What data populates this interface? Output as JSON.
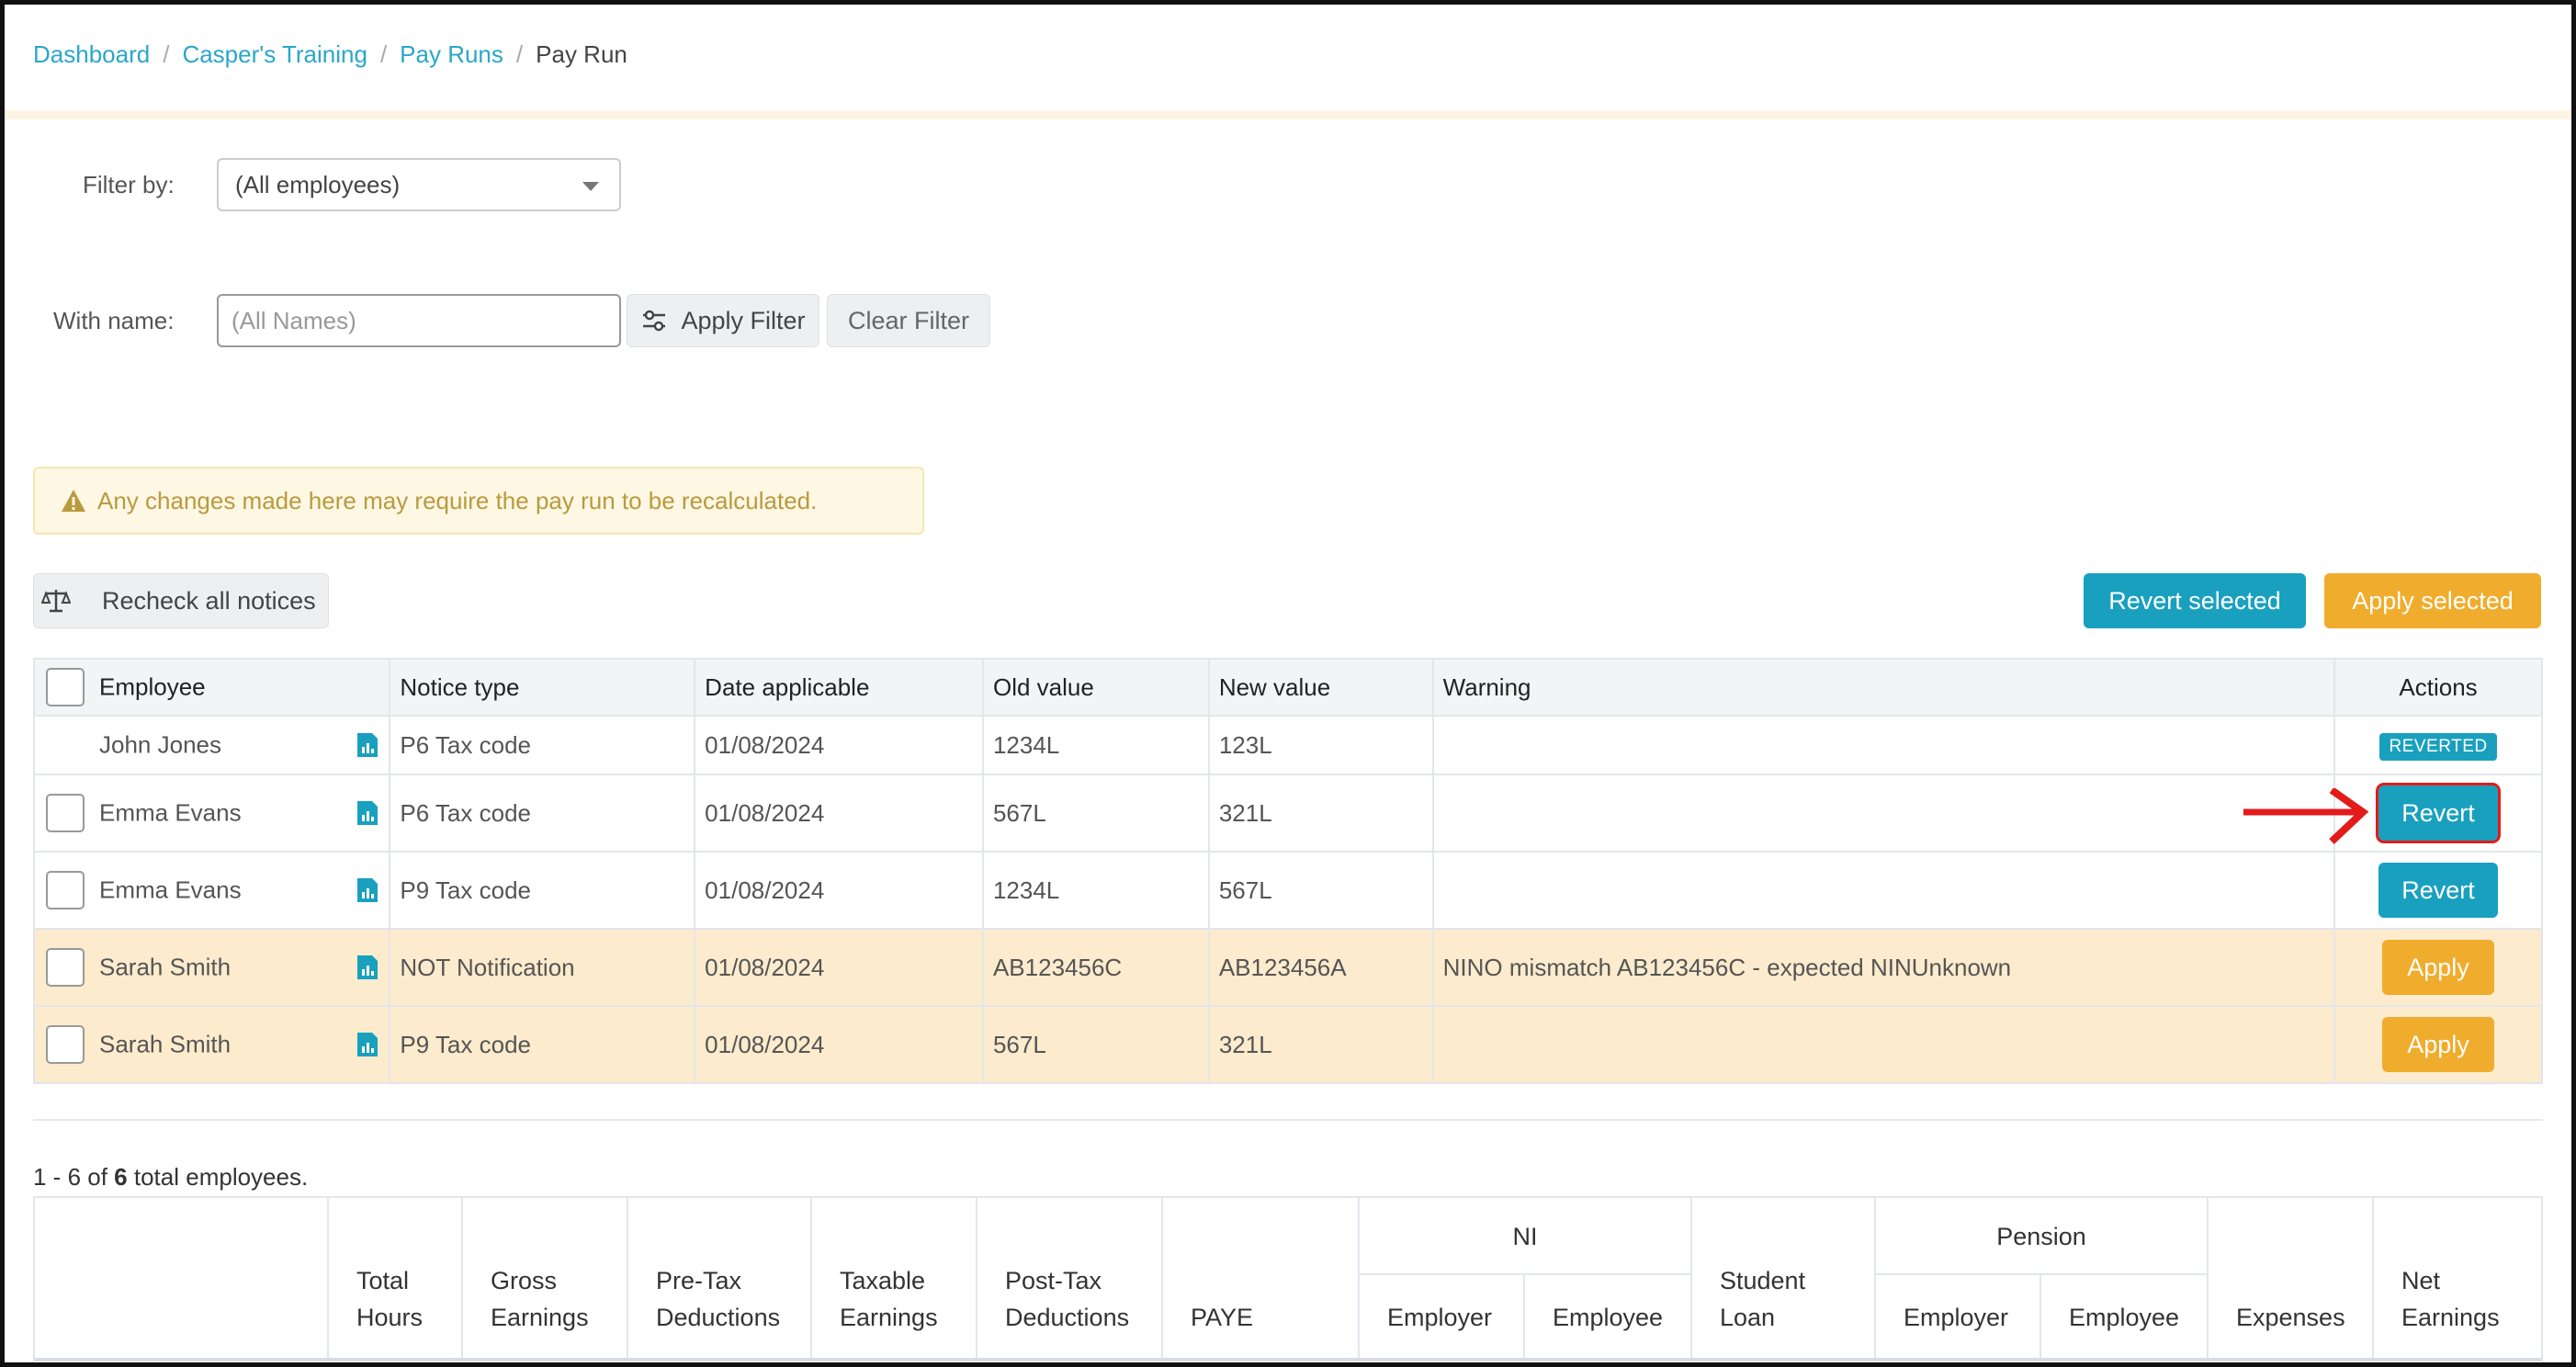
{
  "breadcrumb": {
    "items": [
      "Dashboard",
      "Casper's Training",
      "Pay Runs"
    ],
    "current": "Pay Run"
  },
  "filters": {
    "filter_by_label": "Filter by:",
    "filter_by_value": "(All employees)",
    "with_name_label": "With name:",
    "with_name_placeholder": "(All Names)",
    "apply_filter_label": "Apply Filter",
    "clear_filter_label": "Clear Filter"
  },
  "warning": {
    "text": "Any changes made here may require the pay run to be recalculated."
  },
  "toolbar": {
    "recheck_label": "Recheck all notices",
    "revert_selected_label": "Revert selected",
    "apply_selected_label": "Apply selected"
  },
  "notices": {
    "headers": {
      "employee": "Employee",
      "notice_type": "Notice type",
      "date_applicable": "Date applicable",
      "old_value": "Old value",
      "new_value": "New value",
      "warning": "Warning",
      "actions": "Actions"
    },
    "rows": [
      {
        "employee": "John Jones",
        "notice_type": "P6 Tax code",
        "date": "01/08/2024",
        "old": "1234L",
        "new": "123L",
        "warning": "",
        "action": "REVERTED"
      },
      {
        "employee": "Emma Evans",
        "notice_type": "P6 Tax code",
        "date": "01/08/2024",
        "old": "567L",
        "new": "321L",
        "warning": "",
        "action": "Revert"
      },
      {
        "employee": "Emma Evans",
        "notice_type": "P9 Tax code",
        "date": "01/08/2024",
        "old": "1234L",
        "new": "567L",
        "warning": "",
        "action": "Revert"
      },
      {
        "employee": "Sarah Smith",
        "notice_type": "NOT Notification",
        "date": "01/08/2024",
        "old": "AB123456C",
        "new": "AB123456A",
        "warning": "NINO mismatch AB123456C - expected NINUnknown",
        "action": "Apply"
      },
      {
        "employee": "Sarah Smith",
        "notice_type": "P9 Tax code",
        "date": "01/08/2024",
        "old": "567L",
        "new": "321L",
        "warning": "",
        "action": "Apply"
      }
    ]
  },
  "pagination": {
    "range": "1 - 6 of",
    "total": "6",
    "suffix": "total employees."
  },
  "totals_headers": {
    "total_hours": [
      "Total",
      "Hours"
    ],
    "gross_earnings": [
      "Gross",
      "Earnings"
    ],
    "pre_tax": [
      "Pre-Tax",
      "Deductions"
    ],
    "taxable": [
      "Taxable",
      "Earnings"
    ],
    "post_tax": [
      "Post-Tax",
      "Deductions"
    ],
    "paye": "PAYE",
    "ni": "NI",
    "ni_employer": "Employer",
    "ni_employee": "Employee",
    "student_loan": [
      "Student",
      "Loan"
    ],
    "pension": "Pension",
    "pension_employer": "Employer",
    "pension_employee": "Employee",
    "expenses": "Expenses",
    "net_earnings": [
      "Net",
      "Earnings"
    ]
  },
  "colors": {
    "link": "#2aa7c9",
    "teal": "#1aa0bf",
    "orange": "#f0ac2c",
    "highlight_row": "#fdebcd",
    "annotation": "#e31b1b"
  }
}
